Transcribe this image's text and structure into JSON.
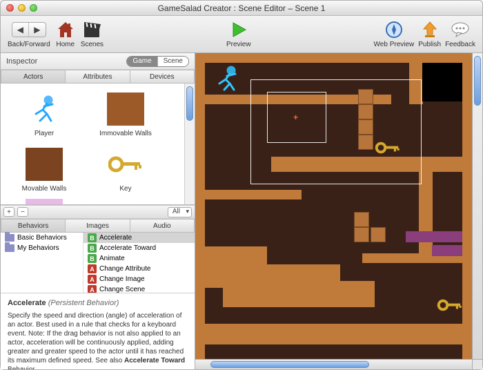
{
  "window": {
    "title": "GameSalad Creator : Scene Editor – Scene 1"
  },
  "toolbar": {
    "backforward_label": "Back/Forward",
    "home_label": "Home",
    "scenes_label": "Scenes",
    "preview_label": "Preview",
    "webpreview_label": "Web Preview",
    "publish_label": "Publish",
    "feedback_label": "Feedback"
  },
  "inspector": {
    "label": "Inspector",
    "toggle": {
      "game": "Game",
      "scene": "Scene"
    },
    "tabs": {
      "actors": "Actors",
      "attributes": "Attributes",
      "devices": "Devices"
    },
    "actors": [
      {
        "name": "Player"
      },
      {
        "name": "Immovable Walls"
      },
      {
        "name": "Movable Walls"
      },
      {
        "name": "Key"
      }
    ],
    "filter_options": "All"
  },
  "library": {
    "tabs": {
      "behaviors": "Behaviors",
      "images": "Images",
      "audio": "Audio"
    },
    "folders": [
      {
        "name": "Basic Behaviors"
      },
      {
        "name": "My Behaviors"
      }
    ],
    "behaviors": [
      {
        "badge": "B",
        "name": "Accelerate",
        "selected": true
      },
      {
        "badge": "B",
        "name": "Accelerate Toward"
      },
      {
        "badge": "B",
        "name": "Animate"
      },
      {
        "badge": "A",
        "name": "Change Attribute"
      },
      {
        "badge": "A",
        "name": "Change Image"
      },
      {
        "badge": "A",
        "name": "Change Scene"
      }
    ]
  },
  "description": {
    "title_bold": "Accelerate",
    "title_italic": "(Persistent Behavior)",
    "body": "Specify the speed and direction (angle) of acceleration of an actor. Best used in a rule that checks for a keyboard event. Note: If the drag behavior is not also applied to an actor, acceleration will be continuously applied, adding greater and greater speed to the actor until it has reached its maximum defined speed. See also ",
    "body_bold_tail": "Accelerate Toward ",
    "body_tail2": "Behavior."
  }
}
